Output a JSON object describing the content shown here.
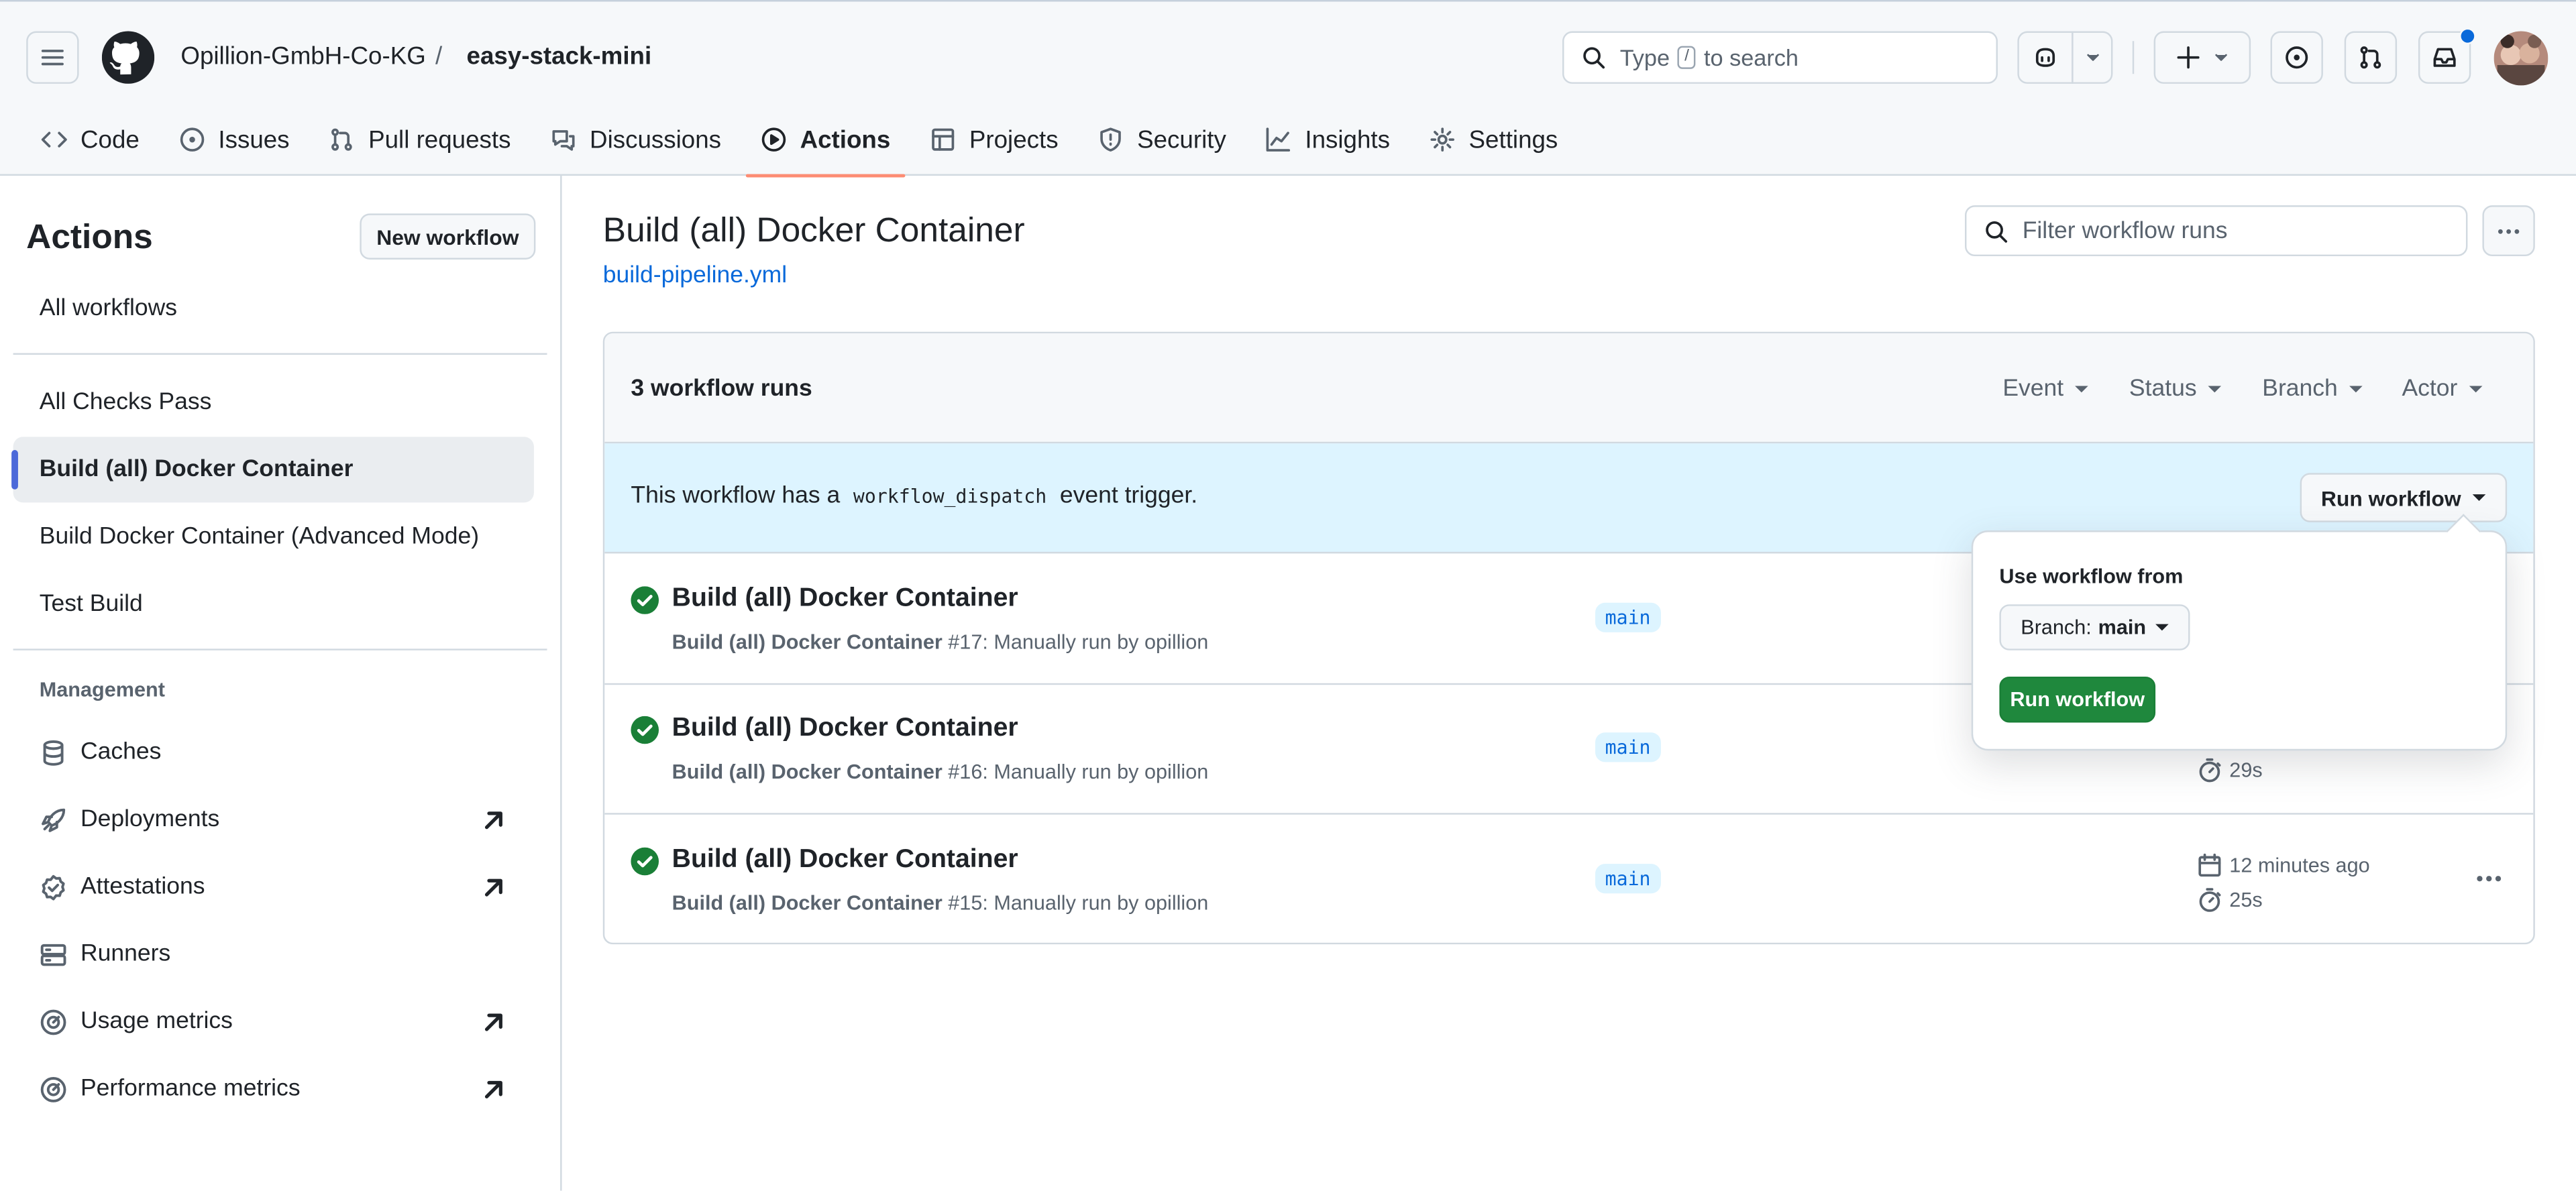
{
  "header": {
    "owner": "Opillion-GmbH-Co-KG",
    "separator": "/",
    "repo": "easy-stack-mini",
    "search_prefix": "Type",
    "search_key": "/",
    "search_suffix": "to search"
  },
  "tabs": [
    {
      "label": "Code",
      "icon": "code-icon"
    },
    {
      "label": "Issues",
      "icon": "issue-icon"
    },
    {
      "label": "Pull requests",
      "icon": "pull-request-icon"
    },
    {
      "label": "Discussions",
      "icon": "discussion-icon"
    },
    {
      "label": "Actions",
      "icon": "play-icon",
      "active": true
    },
    {
      "label": "Projects",
      "icon": "table-icon"
    },
    {
      "label": "Security",
      "icon": "shield-icon"
    },
    {
      "label": "Insights",
      "icon": "graph-icon"
    },
    {
      "label": "Settings",
      "icon": "gear-icon"
    }
  ],
  "sidebar": {
    "title": "Actions",
    "new_workflow": "New workflow",
    "all_workflows": "All workflows",
    "workflows": [
      {
        "label": "All Checks Pass"
      },
      {
        "label": "Build (all) Docker Container",
        "selected": true
      },
      {
        "label": "Build Docker Container (Advanced Mode)"
      },
      {
        "label": "Test Build"
      }
    ],
    "management_heading": "Management",
    "management": [
      {
        "label": "Caches",
        "icon": "database-icon"
      },
      {
        "label": "Deployments",
        "icon": "rocket-icon",
        "external": true
      },
      {
        "label": "Attestations",
        "icon": "verified-icon",
        "external": true
      },
      {
        "label": "Runners",
        "icon": "server-icon"
      },
      {
        "label": "Usage metrics",
        "icon": "meter-icon",
        "external": true
      },
      {
        "label": "Performance metrics",
        "icon": "meter-icon",
        "external": true
      }
    ]
  },
  "main": {
    "title": "Build (all) Docker Container",
    "workflow_file": "build-pipeline.yml",
    "filter_placeholder": "Filter workflow runs",
    "run_count": "3 workflow runs",
    "filters": [
      "Event",
      "Status",
      "Branch",
      "Actor"
    ],
    "banner_prefix": "This workflow has a",
    "banner_code": "workflow_dispatch",
    "banner_suffix": "event trigger.",
    "run_workflow_button": "Run workflow",
    "runs": [
      {
        "title": "Build (all) Docker Container",
        "sub_bold": "Build (all) Docker Container",
        "sub_rest": " #17: Manually run by opillion",
        "branch": "main",
        "time": "",
        "duration": ""
      },
      {
        "title": "Build (all) Docker Container",
        "sub_bold": "Build (all) Docker Container",
        "sub_rest": " #16: Manually run by opillion",
        "branch": "main",
        "time": "",
        "duration": "29s"
      },
      {
        "title": "Build (all) Docker Container",
        "sub_bold": "Build (all) Docker Container",
        "sub_rest": " #15: Manually run by opillion",
        "branch": "main",
        "time": "12 minutes ago",
        "duration": "25s"
      }
    ]
  },
  "popover": {
    "label": "Use workflow from",
    "branch_prefix": "Branch:",
    "branch_value": "main",
    "submit": "Run workflow"
  },
  "colors": {
    "success": "#1a7f37",
    "accent_underline": "#fd8c73",
    "link": "#0969da",
    "primary_button": "#1f883d"
  }
}
